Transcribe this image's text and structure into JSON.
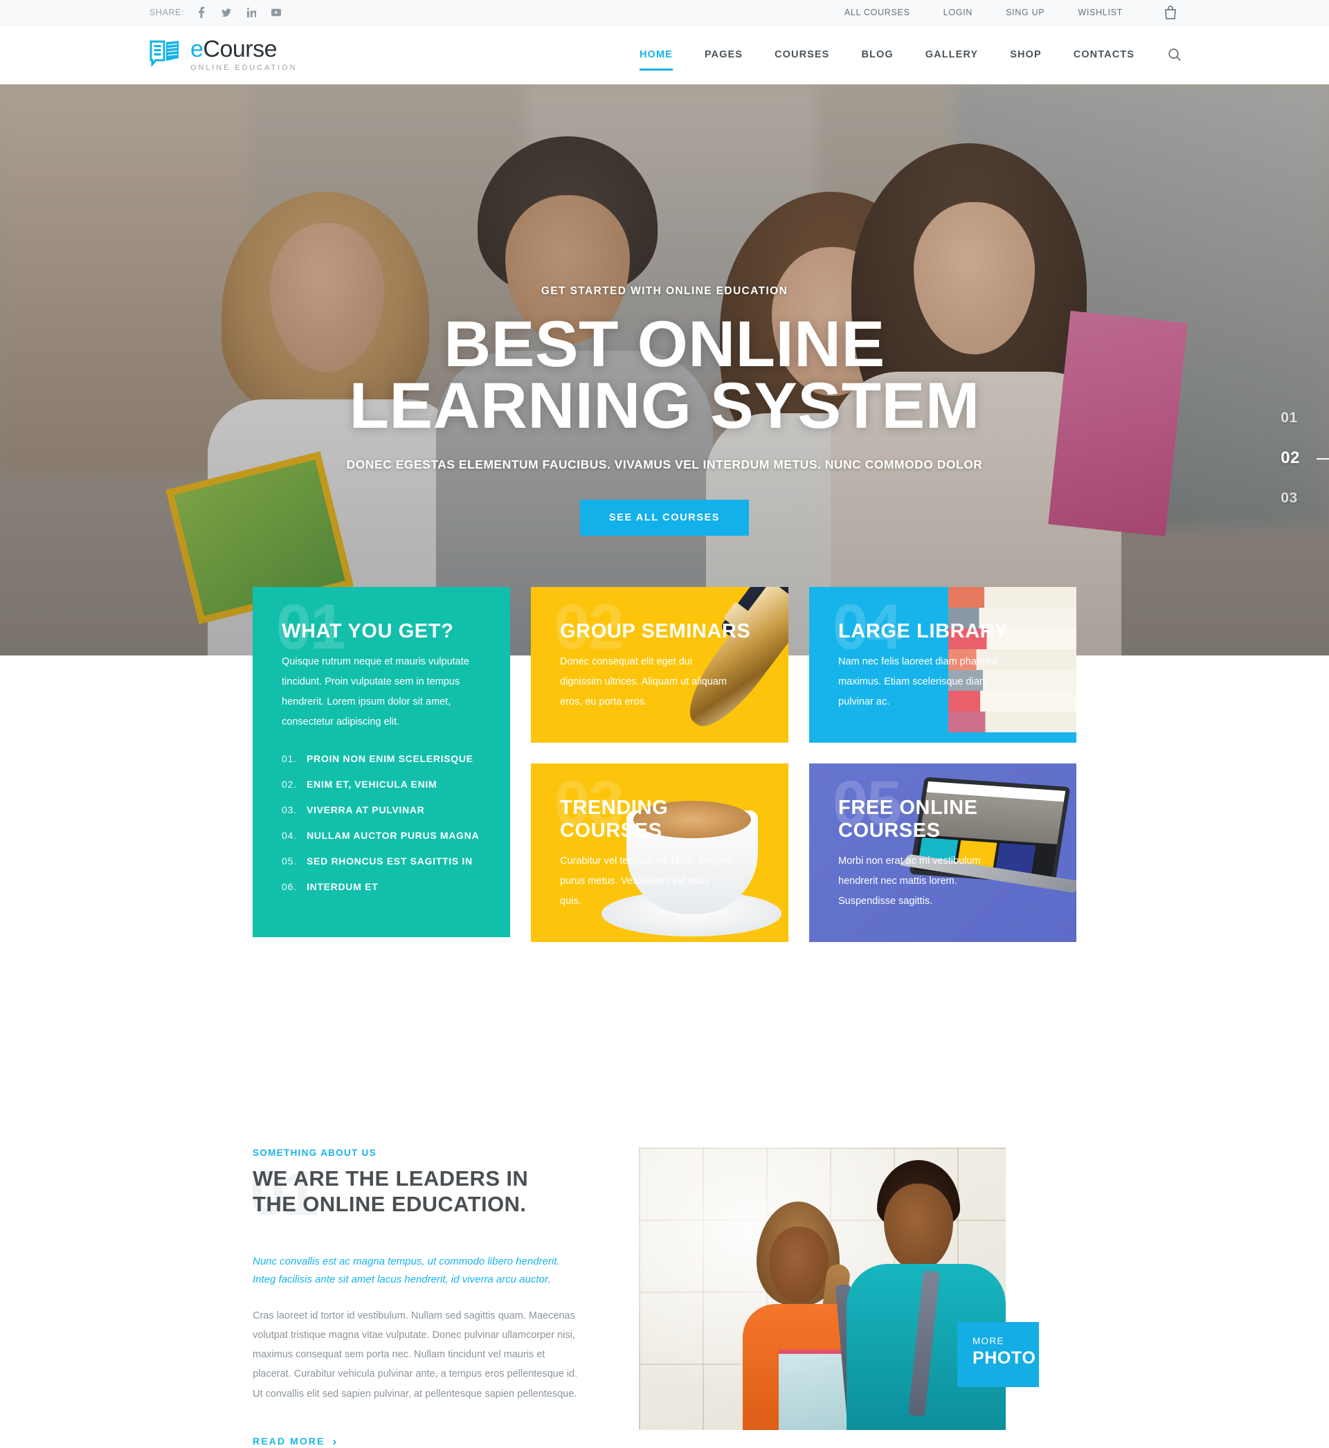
{
  "topbar": {
    "share_label": "SHARE:",
    "social": [
      {
        "name": "facebook-icon",
        "glyph": "f"
      },
      {
        "name": "twitter-icon",
        "glyph": "t"
      },
      {
        "name": "linkedin-icon",
        "glyph": "in"
      },
      {
        "name": "youtube-icon",
        "glyph": "yt"
      }
    ],
    "links": [
      "ALL COURSES",
      "LOGIN",
      "SING UP",
      "WISHLIST"
    ],
    "cart_icon": "shopping-bag-icon"
  },
  "header": {
    "logo": {
      "brand_e": "e",
      "brand_rest": "Course",
      "tagline": "ONLINE EDUCATION"
    },
    "nav": [
      {
        "label": "HOME",
        "active": true
      },
      {
        "label": "PAGES",
        "active": false
      },
      {
        "label": "COURSES",
        "active": false
      },
      {
        "label": "BLOG",
        "active": false
      },
      {
        "label": "GALLERY",
        "active": false
      },
      {
        "label": "SHOP",
        "active": false
      },
      {
        "label": "CONTACTS",
        "active": false
      }
    ],
    "search_icon": "search-icon"
  },
  "hero": {
    "eyebrow": "GET STARTED WITH ONLINE EDUCATION",
    "title_line1": "BEST ONLINE",
    "title_line2": "LEARNING SYSTEM",
    "subtitle": "DONEC EGESTAS ELEMENTUM FAUCIBUS. VIVAMUS VEL INTERDUM METUS. NUNC COMMODO DOLOR",
    "cta": "SEE ALL COURSES",
    "slides": [
      {
        "label": "01",
        "active": false
      },
      {
        "label": "02",
        "active": true
      },
      {
        "label": "03",
        "active": false
      }
    ]
  },
  "cards": {
    "what_you_get": {
      "watermark": "01",
      "title": "WHAT YOU GET?",
      "body": "Quisque rutrum neque et mauris vulputate tincidunt. Proin vulputate sem in tempus hendrerit. Lorem ipsum dolor sit amet, consectetur adipiscing elit.",
      "list": [
        {
          "num": "01.",
          "text": "PROIN NON ENIM SCELERISQUE"
        },
        {
          "num": "02.",
          "text": "ENIM ET, VEHICULA ENIM"
        },
        {
          "num": "03.",
          "text": "VIVERRA AT PULVINAR"
        },
        {
          "num": "04.",
          "text": "NULLAM AUCTOR PURUS MAGNA"
        },
        {
          "num": "05.",
          "text": "SED RHONCUS EST SAGITTIS IN"
        },
        {
          "num": "06.",
          "text": "INTERDUM ET"
        }
      ],
      "color": "#12bfab"
    },
    "group_seminars": {
      "watermark": "02",
      "title": "GROUP SEMINARS",
      "body": "Donec consequat elit eget dui dignissim ultrices. Aliquam ut aliquam eros, eu porta eros.",
      "color": "#fcc50b",
      "art": "fountain-pen-image"
    },
    "trending_courses": {
      "watermark": "03",
      "title": "TRENDING COURSES",
      "body": "Curabitur vel tempus mi. Nunc semper purus metus. Vestibulum vel risus quis.",
      "color": "#fcc50b",
      "art": "coffee-cup-image"
    },
    "large_library": {
      "watermark": "04",
      "title": "LARGE LIBRARY",
      "body": "Nam nec felis laoreet diam pharetra maximus. Etiam scelerisque diam pulvinar ac.",
      "color": "#16b4ea",
      "art": "stacked-books-image"
    },
    "free_online_courses": {
      "watermark": "05",
      "title": "FREE ONLINE COURSES",
      "body": "Morbi non erat ac mi vestibulum hendrerit nec mattis lorem. Suspendisse sagittis.",
      "color": "#6675cf",
      "art": "laptop-image"
    }
  },
  "about": {
    "watermark": "01",
    "eyebrow": "SOMETHING ABOUT US",
    "title": "WE ARE THE LEADERS IN THE ONLINE EDUCATION.",
    "lead": "Nunc convallis est ac magna tempus, ut commodo libero hendrerit. Integ facilisis ante sit amet lacus hendrerit, id viverra arcu auctor.",
    "body": "Cras laoreet id tortor id vestibulum. Nullam sed sagittis quam. Maecenas volutpat tristique magna vitae vulputate. Donec pulvinar ullamcorper nisi, maximus consequat sem porta nec. Nullam tincidunt vel mauris et placerat. Curabitur vehicula pulvinar ante, a tempus eros pellentesque id. Ut convallis elit sed sapien pulvinar, at pellentesque sapien pellentesque.",
    "read_more": "READ MORE",
    "read_more_chevron": "›",
    "photo_badge_small": "MORE",
    "photo_badge_large": "PHOTO",
    "photo_alt": "two-students-image"
  },
  "colors": {
    "accent": "#14b2e6",
    "teal": "#12bfab",
    "yellow": "#fcc50b",
    "blue": "#16b4ea",
    "purple": "#6675cf",
    "text_dark": "#4a4f54",
    "text_muted": "#8b949c"
  }
}
